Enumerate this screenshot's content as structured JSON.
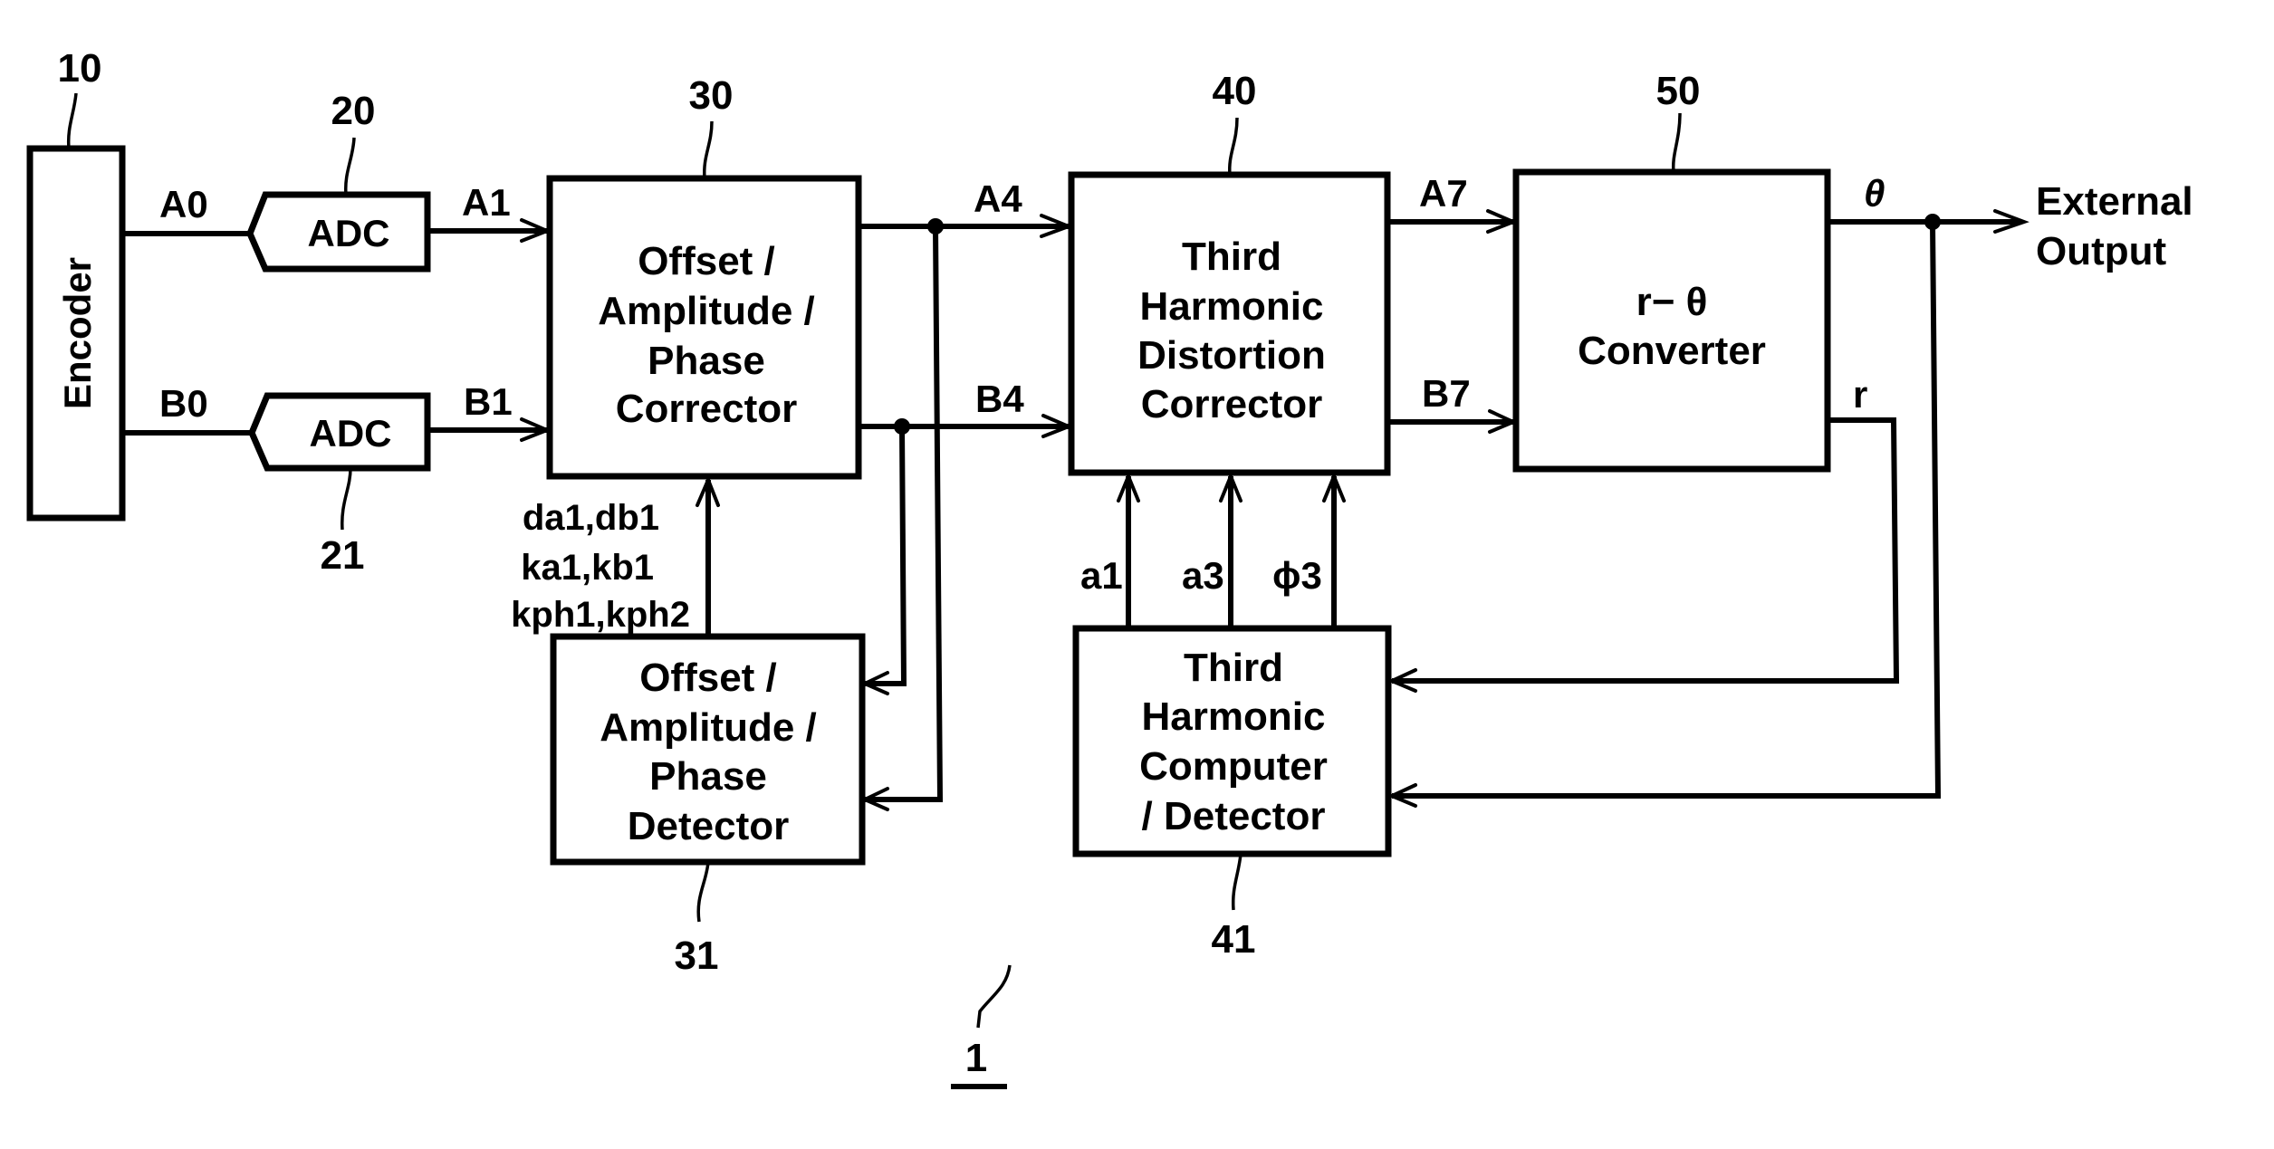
{
  "figure_ref": "1",
  "blocks": {
    "encoder": {
      "ref": "10",
      "label": "Encoder"
    },
    "adc_a": {
      "ref": "20",
      "label": "ADC"
    },
    "adc_b": {
      "ref": "21",
      "label": "ADC"
    },
    "corrector": {
      "ref": "30",
      "lines": [
        "Offset /",
        "Amplitude /",
        "Phase",
        "Corrector"
      ]
    },
    "detector": {
      "ref": "31",
      "lines": [
        "Offset /",
        "Amplitude /",
        "Phase",
        "Detector"
      ]
    },
    "harmonic_corrector": {
      "ref": "40",
      "lines": [
        "Third",
        "Harmonic",
        "Distortion",
        "Corrector"
      ]
    },
    "harmonic_detector": {
      "ref": "41",
      "lines": [
        "Third",
        "Harmonic",
        "Computer",
        "/ Detector"
      ]
    },
    "converter": {
      "ref": "50",
      "lines": [
        "r− θ",
        "Converter"
      ]
    }
  },
  "signals": {
    "a0": "A0",
    "b0": "B0",
    "a1": "A1",
    "b1": "B1",
    "a4": "A4",
    "b4": "B4",
    "a7": "A7",
    "b7": "B7",
    "theta": "θ",
    "r": "r",
    "a1_coef": "a1",
    "a3_coef": "a3",
    "phi3": "ϕ3",
    "params": [
      "da1,db1",
      "ka1,kb1",
      "kph1,kph2"
    ]
  },
  "output": {
    "lines": [
      "External",
      "Output"
    ]
  }
}
